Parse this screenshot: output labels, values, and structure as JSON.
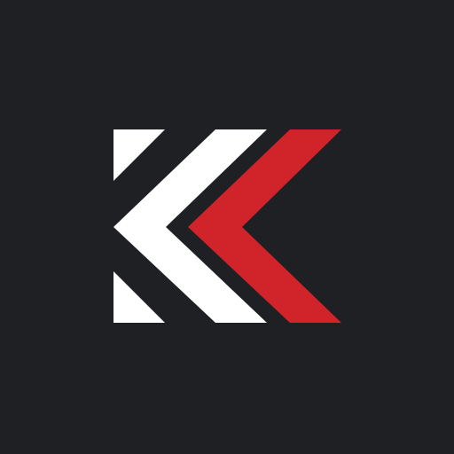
{
  "colors": {
    "background": "#1e2024",
    "mark_white": "#ffffff",
    "mark_red": "#d0232a"
  },
  "icons": {
    "logo": "double-chevron-k-logo-icon"
  }
}
